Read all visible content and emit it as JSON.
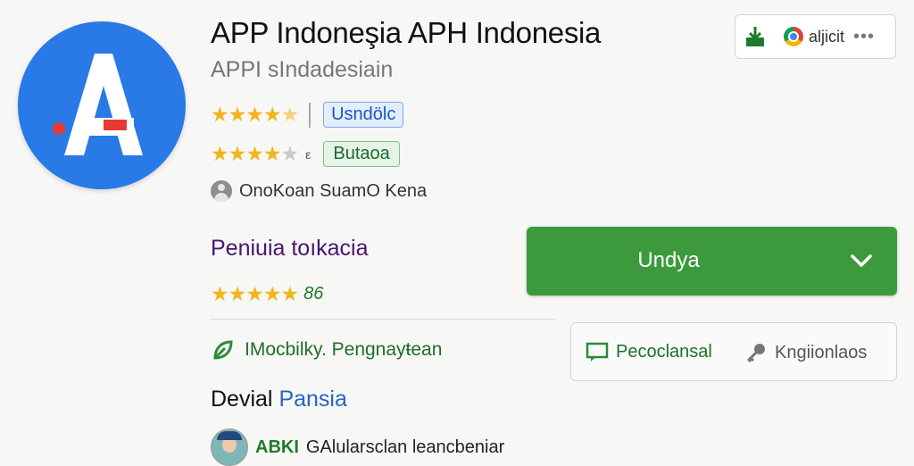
{
  "app": {
    "title": "APP Indoneşia APH Indonesia",
    "subtitle": "APPI sIndadesiain"
  },
  "ratings": {
    "row1": {
      "stars": 4.5,
      "badge": "Usndölc"
    },
    "row2": {
      "stars": 4,
      "mark": "ε",
      "badge": "Butaoa"
    }
  },
  "developer_line": "OnoKoan SuamО Kena",
  "section": {
    "title": "Peniuia tоıkacia",
    "stars": 5,
    "score": "86"
  },
  "compatibility": "IMocbilky. Pengnayŧean",
  "developer_section": {
    "title_part1": "Devial",
    "title_part2": "Pansia"
  },
  "bottom": {
    "code": "ABKI",
    "text": "GAlularsclan leancbeniar"
  },
  "toolbar": {
    "label": "aljicit",
    "more": "•••"
  },
  "install_button": {
    "label": "Undya"
  },
  "actions": {
    "primary": "Pecoclansal",
    "secondary": "Kngiionlaos"
  },
  "colors": {
    "icon_blue": "#2979e6",
    "install_green": "#3c9a3c",
    "star_gold": "#f2b51d"
  }
}
